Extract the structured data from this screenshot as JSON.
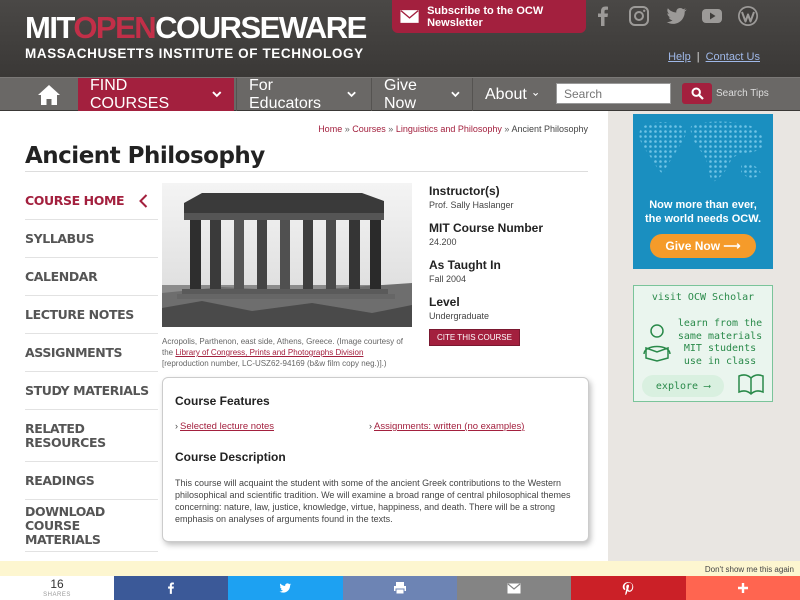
{
  "header": {
    "logo_part1": "MIT",
    "logo_part2": "OPEN",
    "logo_part3": "COURSEWARE",
    "logo_subtitle": "MASSACHUSETTS INSTITUTE OF TECHNOLOGY",
    "newsletter_label": "Subscribe to the OCW Newsletter",
    "help_label": "Help",
    "contact_label": "Contact Us",
    "social_icons": [
      "facebook-icon",
      "instagram-icon",
      "twitter-icon",
      "youtube-icon",
      "wordpress-icon"
    ]
  },
  "nav": {
    "find_courses": "FIND COURSES",
    "for_educators": "For Educators",
    "give_now": "Give Now",
    "about": "About",
    "search_placeholder": "Search",
    "search_tips": "Search Tips"
  },
  "breadcrumb": {
    "home": "Home",
    "courses": "Courses",
    "department": "Linguistics and Philosophy",
    "current": "Ancient Philosophy",
    "separator": "»"
  },
  "page_title": "Ancient Philosophy",
  "left_nav": [
    {
      "label": "COURSE HOME",
      "active": true
    },
    {
      "label": "SYLLABUS"
    },
    {
      "label": "CALENDAR"
    },
    {
      "label": "LECTURE NOTES"
    },
    {
      "label": "ASSIGNMENTS"
    },
    {
      "label": "STUDY MATERIALS"
    },
    {
      "label": "RELATED RESOURCES"
    },
    {
      "label": "READINGS"
    },
    {
      "label": "DOWNLOAD COURSE MATERIALS"
    }
  ],
  "image_caption": {
    "text1": "Acropolis, Parthenon, east side, Athens, Greece. (Image courtesy of the",
    "link": "Library of Congress, Prints and Photographs Division",
    "text2": "[reproduction number, LC-USZ62-94169 (b&w film copy neg.)].)"
  },
  "course_info": {
    "instructor_label": "Instructor(s)",
    "instructor_value": "Prof. Sally Haslanger",
    "number_label": "MIT Course Number",
    "number_value": "24.200",
    "taught_label": "As Taught In",
    "taught_value": "Fall 2004",
    "level_label": "Level",
    "level_value": "Undergraduate",
    "cite_button": "CITE THIS COURSE"
  },
  "features": {
    "heading": "Course Features",
    "items": [
      "Selected lecture notes",
      "Assignments: written (no examples)"
    ],
    "desc_heading": "Course Description",
    "description": "This course will acquaint the student with some of the ancient Greek contributions to the Western philosophical and scientific tradition. We will examine a broad range of central philosophical themes concerning: nature, law, justice, knowledge, virtue, happiness, and death. There will be a strong emphasis on analyses of arguments found in the texts."
  },
  "donate_ad": {
    "line1": "Now more than ever,",
    "line2": "the world needs OCW.",
    "button": "Give Now ⟶"
  },
  "scholar_ad": {
    "heading": "visit OCW Scholar",
    "line1": "learn from the",
    "line2": "same materials",
    "line3": "MIT students",
    "line4": "use in class",
    "button": "explore ⟶"
  },
  "share": {
    "dont_show": "Don't show me this again",
    "count": "16",
    "count_label": "SHARES",
    "colors": {
      "facebook": "#3b5998",
      "twitter": "#1da1f2",
      "print": "#6d84b4",
      "email": "#848484",
      "pinterest": "#cb2027",
      "more": "#ff6550"
    }
  },
  "colors": {
    "brand": "#a3203e",
    "header": "#3f3d3b"
  }
}
